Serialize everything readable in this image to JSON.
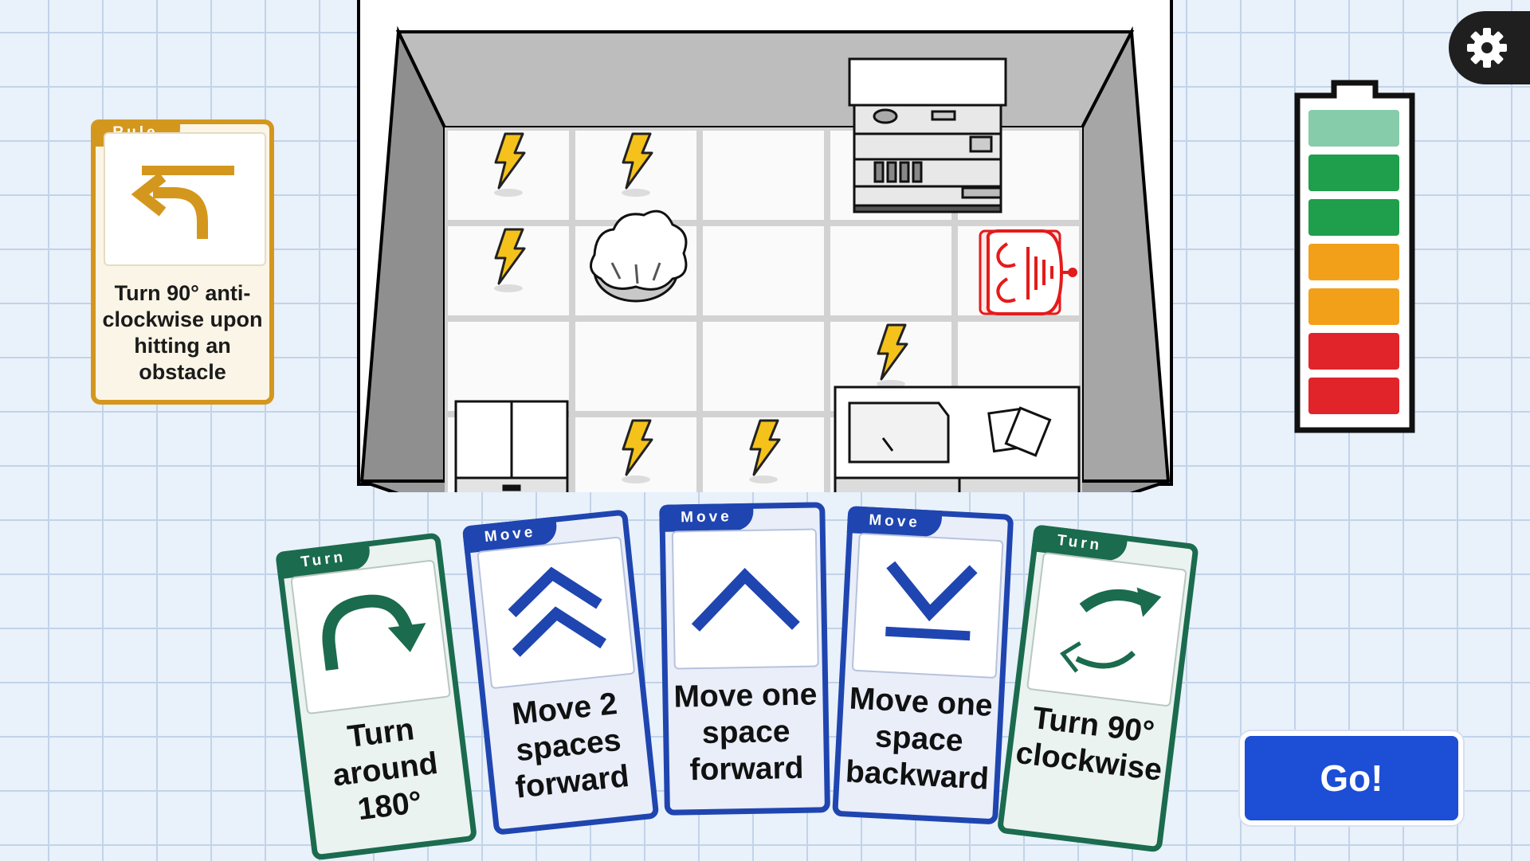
{
  "rule_card": {
    "tab_label": "Rule",
    "text": "Turn 90° anti-clockwise upon hitting an obstacle",
    "icon": "turn-left-arrow-icon",
    "color": "#d4971d"
  },
  "board": {
    "grid": "5x4",
    "robot": {
      "icon": "robot-icon",
      "color": "#e41b1b",
      "row": 2,
      "col": 5
    },
    "energy_bolts": [
      {
        "row": 1,
        "col": 1
      },
      {
        "row": 1,
        "col": 2
      },
      {
        "row": 2,
        "col": 1
      },
      {
        "row": 3,
        "col": 4
      },
      {
        "row": 4,
        "col": 2
      },
      {
        "row": 4,
        "col": 3
      }
    ],
    "obstacles": [
      "shelf-icon",
      "plant-pot-icon",
      "cabinet-icon",
      "desk-icon"
    ]
  },
  "battery": {
    "levels": 7,
    "colors": [
      "#86ccaa",
      "#1f9e4c",
      "#1f9e4c",
      "#f2a01a",
      "#f2a01a",
      "#e0242a",
      "#e0242a"
    ]
  },
  "settings": {
    "icon": "gear-icon"
  },
  "cards": [
    {
      "type": "Turn",
      "text_lines": [
        "Turn",
        "around",
        "180°"
      ],
      "icon": "turn-around-arrow-icon"
    },
    {
      "type": "Move",
      "text_lines": [
        "Move 2",
        "spaces",
        "forward"
      ],
      "icon": "double-chevron-up-icon"
    },
    {
      "type": "Move",
      "text_lines": [
        "Move one",
        "space",
        "forward"
      ],
      "icon": "chevron-up-icon"
    },
    {
      "type": "Move",
      "text_lines": [
        "Move one",
        "space",
        "backward"
      ],
      "icon": "chevron-down-bar-icon"
    },
    {
      "type": "Turn",
      "text_lines": [
        "Turn 90°",
        "clockwise"
      ],
      "icon": "rotate-clockwise-icon"
    }
  ],
  "go_button": {
    "label": "Go!",
    "color": "#1c4ed6"
  },
  "colors": {
    "turn": "#1b6b4e",
    "move": "#1f45b0"
  }
}
